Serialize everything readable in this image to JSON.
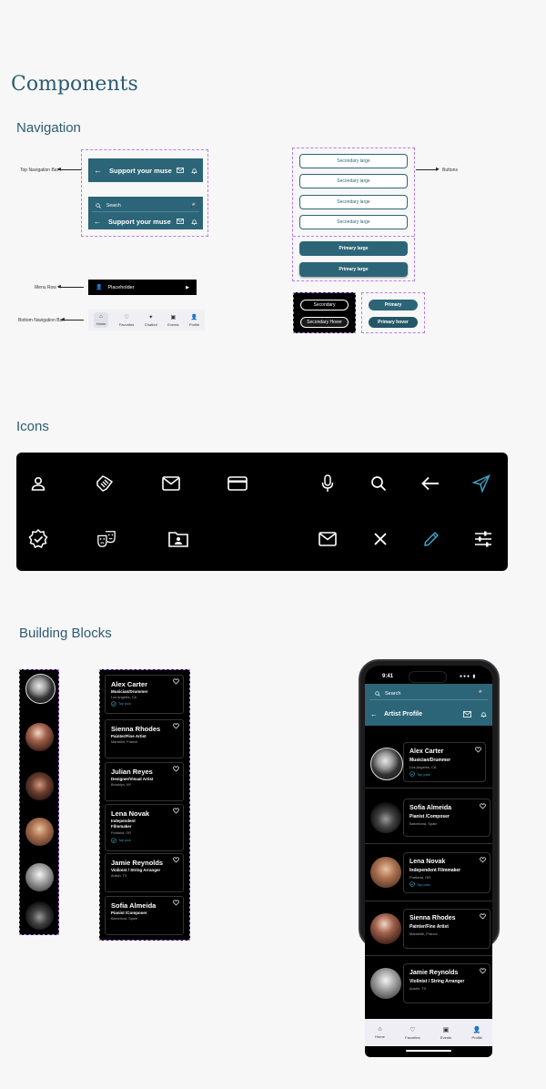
{
  "page": {
    "title": "Components",
    "nav_section": "Navigation",
    "icons_section": "Icons",
    "blocks_section": "Building Blocks"
  },
  "labels": {
    "top_nav": "Top Navigation Bar",
    "menu_row": "Menu Row",
    "bottom_nav": "Bottom Navigation Bar",
    "buttons": "Buttons"
  },
  "topbar": {
    "title": "Support your muse",
    "search_placeholder": "Search"
  },
  "menu_row": {
    "label": "Placeholder"
  },
  "bottom_nav": {
    "items": [
      "Home",
      "Favorites",
      "Chatbot",
      "Events",
      "Profile"
    ]
  },
  "buttons": {
    "secondary_large": [
      "Secondary large",
      "Secondary large",
      "Secondary large",
      "Secondary large"
    ],
    "primary_large": [
      "Primary large",
      "Primary large"
    ],
    "secondary": "Secondary",
    "secondary_hover": "Secondary Hover",
    "primary": "Primary",
    "primary_hover": "Primary hover"
  },
  "icons": {
    "row1": [
      "person-icon",
      "handshake-icon",
      "mail-icon",
      "credit-card-icon",
      "mic-icon",
      "search-icon",
      "arrow-left-icon",
      "send-icon"
    ],
    "row2": [
      "verified-badge-icon",
      "theater-masks-icon",
      "folder-user-icon",
      "mail-icon",
      "close-icon",
      "pencil-icon",
      "tune-icon"
    ]
  },
  "cards": [
    {
      "name": "Alex Carter",
      "role": "Musician/Drummer",
      "location": "Los Angeles, CA",
      "top_pick": "Top pick"
    },
    {
      "name": "Sienna Rhodes",
      "role": "Painter/Fine Artist",
      "location": "Marseille, France",
      "top_pick": ""
    },
    {
      "name": "Julian Reyes",
      "role": "Designer/Visual Artist",
      "location": "Brooklyn, NY",
      "top_pick": ""
    },
    {
      "name": "Lena Novak",
      "role": "Independent Filmmaker",
      "location": "Portland, OR",
      "top_pick": "Top pick"
    },
    {
      "name": "Jamie Reynolds",
      "role": "Violinist / String Arranger",
      "location": "Austin, TX",
      "top_pick": ""
    },
    {
      "name": "Sofia Almeida",
      "role": "Pianist /Composer",
      "location": "Barcelona, Spain",
      "top_pick": ""
    }
  ],
  "phone": {
    "time": "9:41",
    "search_placeholder": "Search",
    "title": "Artist Profile",
    "profiles": [
      {
        "name": "Alex Carter",
        "role": "Musician/Drummer",
        "location": "Los Angeles, CA",
        "top_pick": "Top pick"
      },
      {
        "name": "Sofia Almeida",
        "role": "Pianist /Composer",
        "location": "Barcelona, Spain",
        "top_pick": ""
      },
      {
        "name": "Lena Novak",
        "role": "Independent Filmmaker",
        "location": "Portland, OR",
        "top_pick": "Top pick"
      },
      {
        "name": "Sienna Rhodes",
        "role": "Painter/Fine Artist",
        "location": "Marseille, France",
        "top_pick": ""
      },
      {
        "name": "Jamie Reynolds",
        "role": "Violinist / String Arranger",
        "location": "Austin, TX",
        "top_pick": ""
      }
    ],
    "nav_items": [
      "Home",
      "Favorites",
      "Events",
      "Profile"
    ]
  },
  "colors": {
    "accent": "#2c6577",
    "heading": "#2a5c72",
    "dashed_frame": "#b57cf5",
    "highlight_blue": "#3aa3c4"
  }
}
